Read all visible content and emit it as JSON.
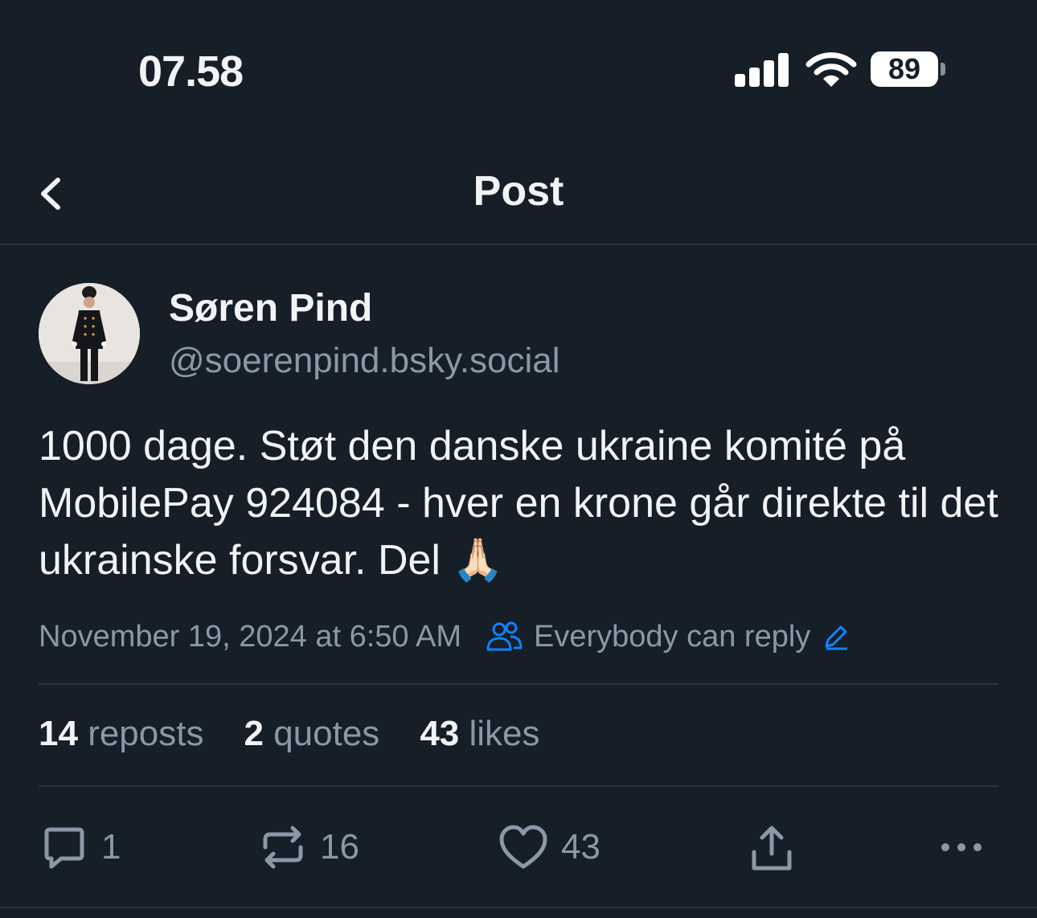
{
  "status_bar": {
    "time": "07.58",
    "battery": "89"
  },
  "header": {
    "title": "Post"
  },
  "author": {
    "name": "Søren Pind",
    "handle": "@soerenpind.bsky.social"
  },
  "post": {
    "text": "1000 dage. Støt den danske ukraine komité på MobilePay 924084 - hver en krone går direkte til det ukrainske forsvar. Del 🙏🏻",
    "timestamp": "November 19, 2024 at 6:50 AM",
    "reply_setting": "Everybody can reply"
  },
  "stats": {
    "reposts_count": "14",
    "reposts_label": "reposts",
    "quotes_count": "2",
    "quotes_label": "quotes",
    "likes_count": "43",
    "likes_label": "likes"
  },
  "actions": {
    "replies": "1",
    "reposts": "16",
    "likes": "43"
  },
  "icons": [
    "back-chevron-icon",
    "people-icon",
    "edit-pencil-icon",
    "reply-bubble-icon",
    "repost-icon",
    "heart-icon",
    "share-icon",
    "more-dots-icon"
  ],
  "colors": {
    "background": "#161e27",
    "text": "#f1f3f5",
    "muted": "#8a98a8",
    "accent": "#1083fe",
    "divider": "#2a333d"
  }
}
